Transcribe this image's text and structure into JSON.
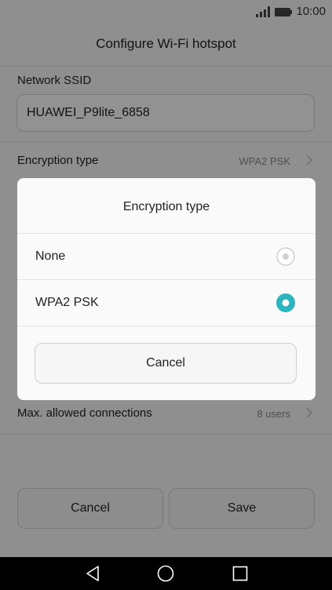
{
  "status_bar": {
    "time": "10:00"
  },
  "header": {
    "title": "Configure Wi-Fi hotspot"
  },
  "ssid": {
    "label": "Network SSID",
    "value": "HUAWEI_P9lite_6858"
  },
  "encryption_row": {
    "label": "Encryption type",
    "value": "WPA2 PSK"
  },
  "max_connections_row": {
    "label": "Max. allowed connections",
    "value": "8 users"
  },
  "footer": {
    "cancel_label": "Cancel",
    "save_label": "Save"
  },
  "dialog": {
    "title": "Encryption type",
    "options": [
      {
        "label": "None",
        "selected": false
      },
      {
        "label": "WPA2 PSK",
        "selected": true
      }
    ],
    "cancel_label": "Cancel"
  },
  "colors": {
    "accent": "#2cb5be",
    "overlay": "#000000"
  }
}
